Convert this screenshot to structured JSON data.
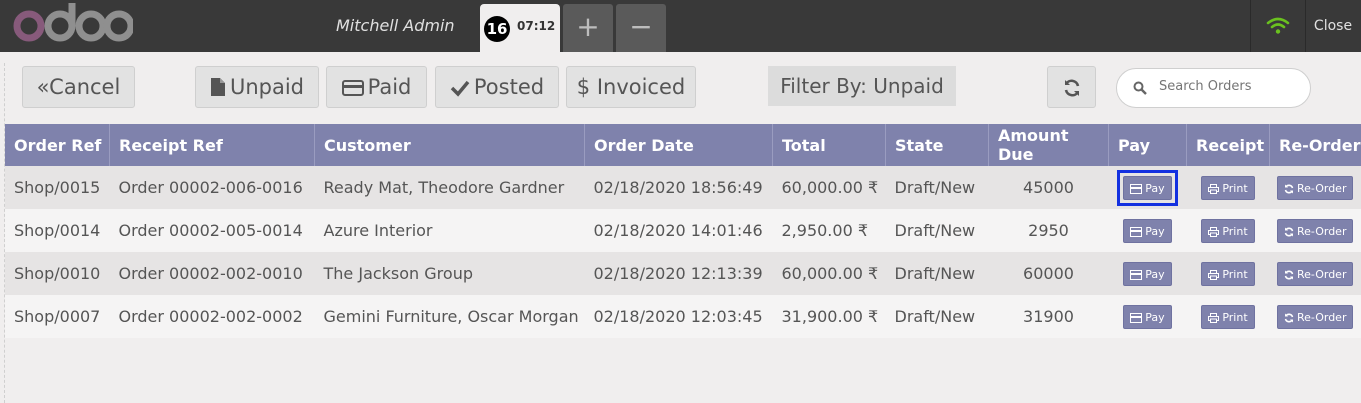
{
  "header": {
    "user": "Mitchell Admin",
    "order_number": "16",
    "order_time": "07:12",
    "add_tab": "+",
    "remove_tab": "−",
    "close_label": "Close"
  },
  "controls": {
    "cancel": "Cancel",
    "unpaid": "Unpaid",
    "paid": "Paid",
    "posted": "Posted",
    "invoiced": "Invoiced",
    "filter": "Filter By: Unpaid",
    "search_placeholder": "Search Orders"
  },
  "table": {
    "headers": [
      "Order Ref",
      "Receipt Ref",
      "Customer",
      "Order Date",
      "Total",
      "State",
      "Amount Due",
      "Pay",
      "Receipt",
      "Re-Order"
    ],
    "rows": [
      {
        "order_ref": "Shop/0015",
        "receipt_ref": "Order 00002-006-0016",
        "customer": "Ready Mat, Theodore Gardner",
        "date": "02/18/2020 18:56:49",
        "total": "60,000.00 ₹",
        "state": "Draft/New",
        "amount_due": "45000"
      },
      {
        "order_ref": "Shop/0014",
        "receipt_ref": "Order 00002-005-0014",
        "customer": "Azure Interior",
        "date": "02/18/2020 14:01:46",
        "total": "2,950.00 ₹",
        "state": "Draft/New",
        "amount_due": "2950"
      },
      {
        "order_ref": "Shop/0010",
        "receipt_ref": "Order 00002-002-0010",
        "customer": "The Jackson Group",
        "date": "02/18/2020 12:13:39",
        "total": "60,000.00 ₹",
        "state": "Draft/New",
        "amount_due": "60000"
      },
      {
        "order_ref": "Shop/0007",
        "receipt_ref": "Order 00002-002-0002",
        "customer": "Gemini Furniture, Oscar Morgan",
        "date": "02/18/2020 12:03:45",
        "total": "31,900.00 ₹",
        "state": "Draft/New",
        "amount_due": "31900"
      }
    ],
    "pay_label": "Pay",
    "print_label": "Print",
    "reorder_label": "Re-Order"
  },
  "colors": {
    "accent": "#7f82ac",
    "topbar": "#393939",
    "selection": "#1330e0",
    "wifi": "#6ac11f",
    "logo_o": "#875a7b"
  },
  "icons": {
    "cancel": "double-chevron-left-icon",
    "unpaid": "file-icon",
    "paid": "credit-card-icon",
    "posted": "check-icon",
    "invoiced": "dollar-icon",
    "refresh": "refresh-icon",
    "search": "search-icon",
    "wifi": "wifi-icon",
    "print": "print-icon"
  }
}
